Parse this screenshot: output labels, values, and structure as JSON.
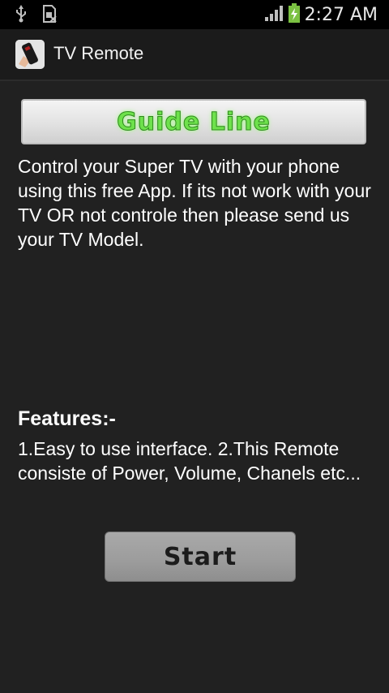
{
  "status_bar": {
    "time": "2:27 AM",
    "icons": [
      "usb-icon",
      "sim-card-icon",
      "signal-icon",
      "battery-charging-icon"
    ]
  },
  "action_bar": {
    "title": "TV Remote",
    "icon": "tv-remote-app-icon"
  },
  "content": {
    "banner_text": "Guide Line",
    "intro_text": "Control your Super TV with your phone using this free App. If its not work with your TV OR not controle then please send us your TV Model.",
    "features_heading": "Features:-",
    "features_text": "1.Easy to use interface. 2.This Remote consiste of Power, Volume, Chanels etc...",
    "start_label": "Start"
  },
  "colors": {
    "background": "#212121",
    "banner_text": "#6ee14c",
    "button": "#9c9c9c"
  }
}
